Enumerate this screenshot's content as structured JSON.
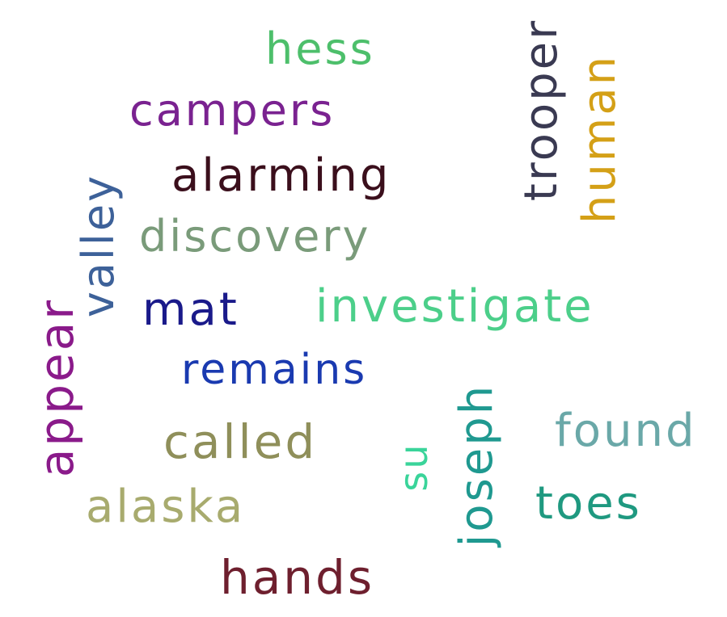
{
  "words": {
    "hess": {
      "text": "hess",
      "color": "#4dbf6b"
    },
    "campers": {
      "text": "campers",
      "color": "#7a2290"
    },
    "alarming": {
      "text": "alarming",
      "color": "#3b0f1c"
    },
    "discovery": {
      "text": "discovery",
      "color": "#7a9b7a"
    },
    "valley": {
      "text": "valley",
      "color": "#3d6199"
    },
    "appear": {
      "text": "appear",
      "color": "#8a1a8a"
    },
    "mat": {
      "text": "mat",
      "color": "#1a1a8a"
    },
    "investigate": {
      "text": "investigate",
      "color": "#4ccf8a"
    },
    "remains": {
      "text": "remains",
      "color": "#1a3ab0"
    },
    "called": {
      "text": "called",
      "color": "#8f8f5a"
    },
    "alaska": {
      "text": "alaska",
      "color": "#a8ab6e"
    },
    "hands": {
      "text": "hands",
      "color": "#6e1f2e"
    },
    "trooper": {
      "text": "trooper",
      "color": "#3a3a52"
    },
    "human": {
      "text": "human",
      "color": "#d4a017"
    },
    "found": {
      "text": "found",
      "color": "#6aa8a8"
    },
    "toes": {
      "text": "toes",
      "color": "#1f9980"
    },
    "joseph": {
      "text": "joseph",
      "color": "#1f9990"
    },
    "su": {
      "text": "su",
      "color": "#3ad49a"
    }
  }
}
